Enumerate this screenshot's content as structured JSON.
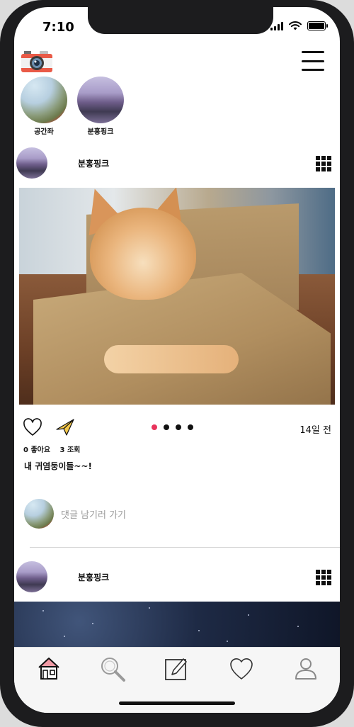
{
  "status_bar": {
    "time": "7:10"
  },
  "header": {
    "logo_icon": "camera-icon",
    "menu_icon": "hamburger-menu-icon"
  },
  "stories": [
    {
      "name": "공간좌",
      "avatar": "mountain"
    },
    {
      "name": "분홍핑크",
      "avatar": "waterfall"
    }
  ],
  "posts": [
    {
      "username": "분홍핑크",
      "image": "cat-in-box",
      "time_ago": "14일 전",
      "likes": "0 좋아요",
      "views": "3 조회",
      "caption": "내 귀염둥이들~~!",
      "carousel": {
        "count": 4,
        "active_index": 0
      },
      "comment_placeholder": "댓글 남기러 가기"
    },
    {
      "username": "분홍핑크",
      "image": "night-sky"
    }
  ],
  "colors": {
    "accent": "#e8335b",
    "text": "#111111",
    "muted": "#9b9b9b"
  },
  "tabbar": {
    "tabs": [
      {
        "name": "home",
        "icon": "home-icon",
        "active": true
      },
      {
        "name": "search",
        "icon": "search-icon",
        "active": false
      },
      {
        "name": "write",
        "icon": "edit-icon",
        "active": false
      },
      {
        "name": "activity",
        "icon": "heart-icon",
        "active": false
      },
      {
        "name": "profile",
        "icon": "profile-icon",
        "active": false
      }
    ]
  }
}
